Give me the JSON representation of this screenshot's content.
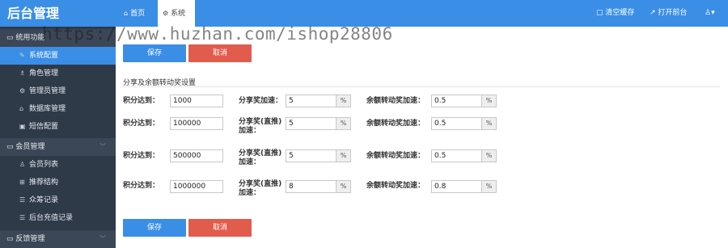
{
  "app": {
    "title": "后台管理"
  },
  "tabs": [
    {
      "label": "首页",
      "icon": "home-icon"
    },
    {
      "label": "系统",
      "icon": "gear-icon"
    }
  ],
  "topbar": {
    "clear_cache": "清空缓存",
    "open_front": "打开前台",
    "user_icon": "user-icon"
  },
  "sidebar": {
    "group_system": "统用功能",
    "system_items": [
      {
        "label": "系统配置",
        "icon": "wrench-icon",
        "active": true
      },
      {
        "label": "角色管理",
        "icon": "users-icon"
      },
      {
        "label": "管理员管理",
        "icon": "gear-icon"
      },
      {
        "label": "数据库管理",
        "icon": "lock-icon"
      },
      {
        "label": "短信配置",
        "icon": "image-icon"
      }
    ],
    "group_member": "会员管理",
    "member_items": [
      {
        "label": "会员列表",
        "icon": "user-icon"
      },
      {
        "label": "推荐结构",
        "icon": "grid-icon"
      },
      {
        "label": "众筹记录",
        "icon": "list-icon"
      },
      {
        "label": "后台充值记录",
        "icon": "list-icon"
      }
    ],
    "group_feedback": "反馈管理"
  },
  "form": {
    "save_label": "保存",
    "cancel_label": "取消",
    "section_title": "分享及余额转动奖设置",
    "rows": [
      {
        "points_label": "积分达到：",
        "points": "1000",
        "share_label": "分享奖加速：",
        "share": "5",
        "balance_label": "余额转动奖加速：",
        "balance": "0.5"
      },
      {
        "points_label": "积分达到：",
        "points": "100000",
        "share_label": "分享奖(直推)加速：",
        "share": "5",
        "balance_label": "余额转动奖加速：",
        "balance": "0.5"
      },
      {
        "points_label": "积分达到：",
        "points": "500000",
        "share_label": "分享奖(直推)加速：",
        "share": "5",
        "balance_label": "余额转动奖加速：",
        "balance": "0.5"
      },
      {
        "points_label": "积分达到：",
        "points": "1000000",
        "share_label": "分享奖(直推)加速：",
        "share": "8",
        "balance_label": "余额转动奖加速：",
        "balance": "0.8"
      }
    ],
    "percent": "%"
  },
  "watermark": "https://www.huzhan.com/ishop28806"
}
